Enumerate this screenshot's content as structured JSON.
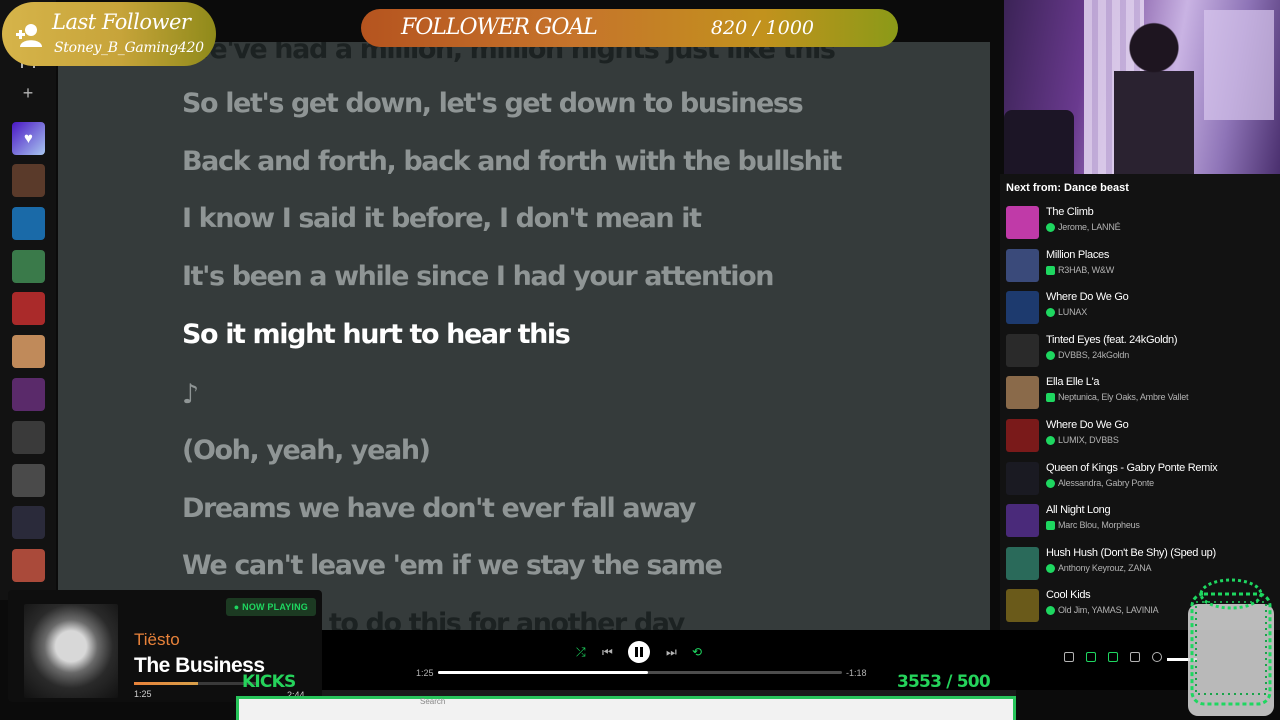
{
  "overlays": {
    "last_follower": {
      "title": "Last Follower",
      "name": "Stoney_B_Gaming420"
    },
    "follower_goal": {
      "label": "FOLLOWER GOAL",
      "count": "820  /  1000",
      "progress": 0.82
    },
    "kicks": {
      "label": "KICKS",
      "count": "3553  / 500"
    }
  },
  "lyrics": [
    {
      "text": "We've had a million, million nights just like this",
      "state": "dim"
    },
    {
      "text": "So let's get down, let's get down to business",
      "state": "past"
    },
    {
      "text": "Back and forth, back and forth with the bullshit",
      "state": "past"
    },
    {
      "text": "I know I said it before, I don't mean it",
      "state": "past"
    },
    {
      "text": "It's been a while since I had your attention",
      "state": "past"
    },
    {
      "text": "So it might hurt to hear this",
      "state": "active"
    },
    {
      "text": "♪",
      "state": "upcoming"
    },
    {
      "text": "(Ooh, yeah, yeah)",
      "state": "upcoming"
    },
    {
      "text": "Dreams we have don't ever fall away",
      "state": "upcoming"
    },
    {
      "text": "We can't leave 'em if we stay the same",
      "state": "upcoming"
    },
    {
      "text": "We've got to do this for another day",
      "state": "dim"
    }
  ],
  "queue": {
    "heading": "Next from: Dance beast",
    "items": [
      {
        "title": "The Climb",
        "artists": "Jerome, LANNÉ",
        "color": "#c03aa8"
      },
      {
        "title": "Million Places",
        "artists": "R3HAB, W&W",
        "color": "#3a4a7a"
      },
      {
        "title": "Where Do We Go",
        "artists": "LUNAX",
        "color": "#1d3a6e"
      },
      {
        "title": "Tinted Eyes (feat. 24kGoldn)",
        "artists": "DVBBS, 24kGoldn",
        "color": "#2a2a2a"
      },
      {
        "title": "Ella Elle L'a",
        "artists": "Neptunica, Ely Oaks, Ambre Vallet",
        "color": "#8a6a4a"
      },
      {
        "title": "Where Do We Go",
        "artists": "LUMIX, DVBBS",
        "color": "#7a1a1a"
      },
      {
        "title": "Queen of Kings - Gabry Ponte Remix",
        "artists": "Alessandra, Gabry Ponte",
        "color": "#1a1a22"
      },
      {
        "title": "All Night Long",
        "artists": "Marc Blou, Morpheus",
        "color": "#4a2a7a"
      },
      {
        "title": "Hush Hush (Don't Be Shy) (Sped up)",
        "artists": "Anthony Keyrouz, ZANA",
        "color": "#2a6a5a"
      },
      {
        "title": "Cool Kids",
        "artists": "Old Jim, YAMAS, LAVINIA",
        "color": "#6a5a1a"
      }
    ]
  },
  "now_playing": {
    "badge": "NOW PLAYING",
    "artist": "Tiësto",
    "track": "The Business",
    "elapsed": "1:25",
    "total": "2:44",
    "progress": 0.52
  },
  "player": {
    "elapsed": "1:25",
    "remaining": "-1:18",
    "progress": 0.52
  },
  "taskbar": {
    "search_placeholder": "Search"
  },
  "sidebar": {
    "thumbs": [
      "#5a3a2a",
      "#1a6aa8",
      "#3a7a4a",
      "#aa2a2a",
      "#c08a5a",
      "#5a2a6a",
      "#3a3a3a",
      "#4a4a4a",
      "#2a2a3a",
      "#aa4a3a"
    ]
  }
}
